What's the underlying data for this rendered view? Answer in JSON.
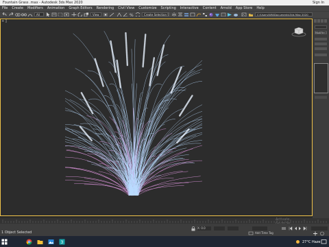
{
  "window": {
    "title": "Fountain Grass .max - Autodesk 3ds Max 2020",
    "signin": "Sign In"
  },
  "menu": [
    "File",
    "Create",
    "Modifiers",
    "Animation",
    "Graph Editors",
    "Rendering",
    "Civil View",
    "Customize",
    "Scripting",
    "Interactive",
    "Content",
    "Arnold",
    "App Store",
    "Help"
  ],
  "toolbar": {
    "filter_value": "All",
    "view_value": "View",
    "selection_set": "Create Selection Set",
    "workspace_path": "C:\\Users\\WN\\Documents\\3ds Max 2020"
  },
  "command_panel": {
    "label": "Modifier List"
  },
  "viewport": {
    "label": "+ ]"
  },
  "status": {
    "selection": "1 Object Selected",
    "coord_x": "X: 0.0",
    "add_time_tag": "Add Time Tag",
    "watermark_line1": "Activate",
    "watermark_line2": "Go to Se"
  },
  "taskbar": {
    "temperature": "27°C Haze",
    "time": ""
  },
  "colors": {
    "accent": "#f0c34a",
    "grass_blue": "#b9dcff",
    "grass_pink": "#e89be8"
  }
}
